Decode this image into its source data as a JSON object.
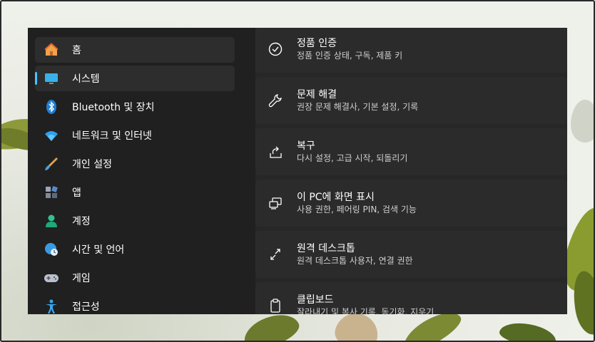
{
  "sidebar": {
    "items": [
      {
        "label": "홈",
        "icon": "home-icon"
      },
      {
        "label": "시스템",
        "icon": "monitor-icon",
        "active": true
      },
      {
        "label": "Bluetooth 및 장치",
        "icon": "bluetooth-icon"
      },
      {
        "label": "네트워크 및 인터넷",
        "icon": "wifi-icon"
      },
      {
        "label": "개인 설정",
        "icon": "brush-icon"
      },
      {
        "label": "앱",
        "icon": "apps-icon"
      },
      {
        "label": "계정",
        "icon": "person-icon"
      },
      {
        "label": "시간 및 언어",
        "icon": "globe-clock-icon"
      },
      {
        "label": "게임",
        "icon": "gamepad-icon"
      },
      {
        "label": "접근성",
        "icon": "accessibility-icon"
      }
    ]
  },
  "main": {
    "cards": [
      {
        "title": "정품 인증",
        "subtitle": "정품 인증 상태, 구독, 제품 키",
        "icon": "checkmark-circle-icon"
      },
      {
        "title": "문제 해결",
        "subtitle": "권장 문제 해결사, 기본 설정, 기록",
        "icon": "wrench-icon"
      },
      {
        "title": "복구",
        "subtitle": "다시 설정, 고급 시작, 되돌리기",
        "icon": "recovery-icon"
      },
      {
        "title": "이 PC에 화면 표시",
        "subtitle": "사용 권한, 페어링 PIN, 검색 기능",
        "icon": "project-screen-icon"
      },
      {
        "title": "원격 데스크톱",
        "subtitle": "원격 데스크톱 사용자, 연결 권한",
        "icon": "remote-desktop-icon"
      },
      {
        "title": "클립보드",
        "subtitle": "잘라내기 및 복사 기록, 동기화, 지우기",
        "icon": "clipboard-icon"
      }
    ]
  },
  "colors": {
    "accent": "#4cc2ff",
    "window_bg": "#202020",
    "card_bg": "#2b2b2b"
  }
}
